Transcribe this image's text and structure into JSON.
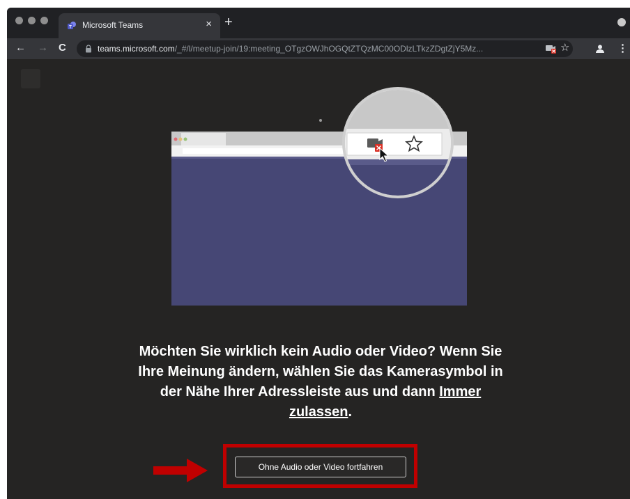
{
  "browser": {
    "tab_title": "Microsoft Teams",
    "tab_close": "×",
    "new_tab": "+",
    "url_host": "teams.microsoft.com",
    "url_path": "/_#/l/meetup-join/19:meeting_OTgzOWJhOGQtZTQzMC00ODlzLTkzZDgtZjY5Mz...",
    "back_icon": "←",
    "forward_icon": "→",
    "reload_icon": "C",
    "star_icon": "☆",
    "menu_icon": "⋮"
  },
  "prompt": {
    "line1": "Möchten Sie wirklich kein Audio oder Video? Wenn Sie",
    "line2": "Ihre Meinung ändern, wählen Sie das Kamerasymbol in",
    "line3_pre": "der Nähe Ihrer Adressleiste aus und dann ",
    "link_part1": "Immer",
    "link_part2": "zulassen",
    "end": "."
  },
  "actions": {
    "continue_label": "Ohne Audio oder Video fortfahren"
  },
  "colors": {
    "page_bg": "#252423",
    "illustration_purple": "#464775",
    "highlight_red": "#c00000"
  }
}
